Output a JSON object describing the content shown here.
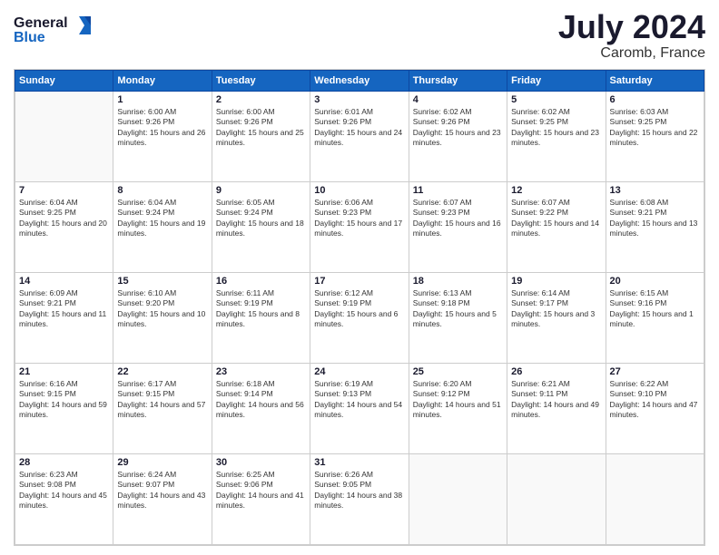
{
  "header": {
    "logo_line1": "General",
    "logo_line2": "Blue",
    "month_title": "July 2024",
    "location": "Caromb, France"
  },
  "weekdays": [
    "Sunday",
    "Monday",
    "Tuesday",
    "Wednesday",
    "Thursday",
    "Friday",
    "Saturday"
  ],
  "weeks": [
    [
      null,
      {
        "day": 1,
        "sunrise": "6:00 AM",
        "sunset": "9:26 PM",
        "daylight": "15 hours and 26 minutes."
      },
      {
        "day": 2,
        "sunrise": "6:00 AM",
        "sunset": "9:26 PM",
        "daylight": "15 hours and 25 minutes."
      },
      {
        "day": 3,
        "sunrise": "6:01 AM",
        "sunset": "9:26 PM",
        "daylight": "15 hours and 24 minutes."
      },
      {
        "day": 4,
        "sunrise": "6:02 AM",
        "sunset": "9:26 PM",
        "daylight": "15 hours and 23 minutes."
      },
      {
        "day": 5,
        "sunrise": "6:02 AM",
        "sunset": "9:25 PM",
        "daylight": "15 hours and 23 minutes."
      },
      {
        "day": 6,
        "sunrise": "6:03 AM",
        "sunset": "9:25 PM",
        "daylight": "15 hours and 22 minutes."
      }
    ],
    [
      {
        "day": 7,
        "sunrise": "6:04 AM",
        "sunset": "9:25 PM",
        "daylight": "15 hours and 20 minutes."
      },
      {
        "day": 8,
        "sunrise": "6:04 AM",
        "sunset": "9:24 PM",
        "daylight": "15 hours and 19 minutes."
      },
      {
        "day": 9,
        "sunrise": "6:05 AM",
        "sunset": "9:24 PM",
        "daylight": "15 hours and 18 minutes."
      },
      {
        "day": 10,
        "sunrise": "6:06 AM",
        "sunset": "9:23 PM",
        "daylight": "15 hours and 17 minutes."
      },
      {
        "day": 11,
        "sunrise": "6:07 AM",
        "sunset": "9:23 PM",
        "daylight": "15 hours and 16 minutes."
      },
      {
        "day": 12,
        "sunrise": "6:07 AM",
        "sunset": "9:22 PM",
        "daylight": "15 hours and 14 minutes."
      },
      {
        "day": 13,
        "sunrise": "6:08 AM",
        "sunset": "9:21 PM",
        "daylight": "15 hours and 13 minutes."
      }
    ],
    [
      {
        "day": 14,
        "sunrise": "6:09 AM",
        "sunset": "9:21 PM",
        "daylight": "15 hours and 11 minutes."
      },
      {
        "day": 15,
        "sunrise": "6:10 AM",
        "sunset": "9:20 PM",
        "daylight": "15 hours and 10 minutes."
      },
      {
        "day": 16,
        "sunrise": "6:11 AM",
        "sunset": "9:19 PM",
        "daylight": "15 hours and 8 minutes."
      },
      {
        "day": 17,
        "sunrise": "6:12 AM",
        "sunset": "9:19 PM",
        "daylight": "15 hours and 6 minutes."
      },
      {
        "day": 18,
        "sunrise": "6:13 AM",
        "sunset": "9:18 PM",
        "daylight": "15 hours and 5 minutes."
      },
      {
        "day": 19,
        "sunrise": "6:14 AM",
        "sunset": "9:17 PM",
        "daylight": "15 hours and 3 minutes."
      },
      {
        "day": 20,
        "sunrise": "6:15 AM",
        "sunset": "9:16 PM",
        "daylight": "15 hours and 1 minute."
      }
    ],
    [
      {
        "day": 21,
        "sunrise": "6:16 AM",
        "sunset": "9:15 PM",
        "daylight": "14 hours and 59 minutes."
      },
      {
        "day": 22,
        "sunrise": "6:17 AM",
        "sunset": "9:15 PM",
        "daylight": "14 hours and 57 minutes."
      },
      {
        "day": 23,
        "sunrise": "6:18 AM",
        "sunset": "9:14 PM",
        "daylight": "14 hours and 56 minutes."
      },
      {
        "day": 24,
        "sunrise": "6:19 AM",
        "sunset": "9:13 PM",
        "daylight": "14 hours and 54 minutes."
      },
      {
        "day": 25,
        "sunrise": "6:20 AM",
        "sunset": "9:12 PM",
        "daylight": "14 hours and 51 minutes."
      },
      {
        "day": 26,
        "sunrise": "6:21 AM",
        "sunset": "9:11 PM",
        "daylight": "14 hours and 49 minutes."
      },
      {
        "day": 27,
        "sunrise": "6:22 AM",
        "sunset": "9:10 PM",
        "daylight": "14 hours and 47 minutes."
      }
    ],
    [
      {
        "day": 28,
        "sunrise": "6:23 AM",
        "sunset": "9:08 PM",
        "daylight": "14 hours and 45 minutes."
      },
      {
        "day": 29,
        "sunrise": "6:24 AM",
        "sunset": "9:07 PM",
        "daylight": "14 hours and 43 minutes."
      },
      {
        "day": 30,
        "sunrise": "6:25 AM",
        "sunset": "9:06 PM",
        "daylight": "14 hours and 41 minutes."
      },
      {
        "day": 31,
        "sunrise": "6:26 AM",
        "sunset": "9:05 PM",
        "daylight": "14 hours and 38 minutes."
      },
      null,
      null,
      null
    ]
  ]
}
